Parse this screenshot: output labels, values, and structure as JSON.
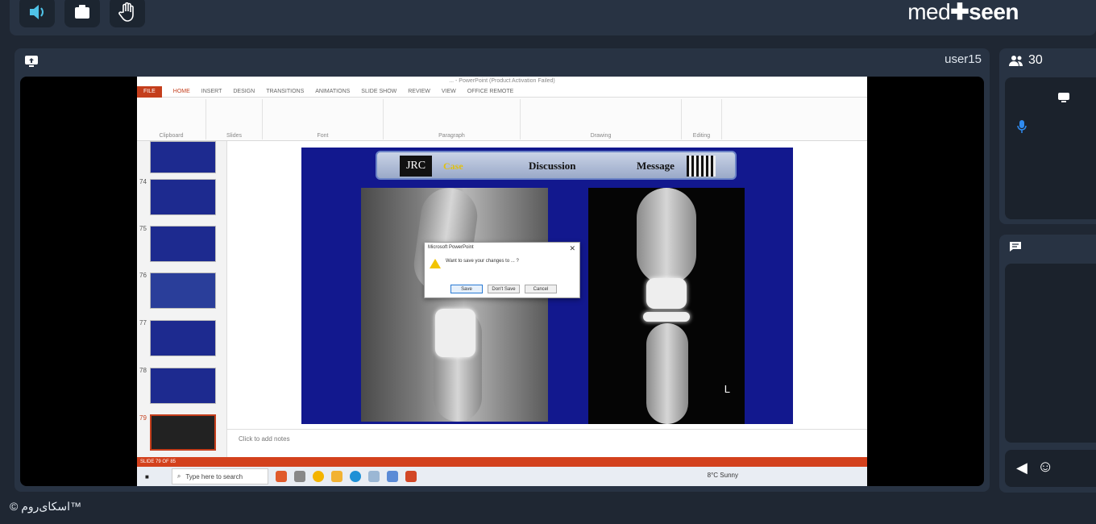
{
  "topbar": {
    "buttons": [
      "speaker-icon",
      "presentation-icon",
      "raise-hand-icon"
    ],
    "logo_left": "med",
    "logo_right": "seen"
  },
  "stage": {
    "presenter": "user15"
  },
  "powerpoint": {
    "title": "... - PowerPoint (Product Activation Failed)",
    "menu": [
      "FILE",
      "HOME",
      "INSERT",
      "DESIGN",
      "TRANSITIONS",
      "ANIMATIONS",
      "SLIDE SHOW",
      "REVIEW",
      "VIEW",
      "OFFICE REMOTE"
    ],
    "ribbon_groups": [
      "Clipboard",
      "Slides",
      "Font",
      "Paragraph",
      "Drawing",
      "Editing"
    ],
    "thumb_numbers": [
      "74",
      "75",
      "76",
      "77",
      "78",
      "79"
    ],
    "slide": {
      "logo": "JRC",
      "case": "Case",
      "discussion": "Discussion",
      "message": "Message",
      "side_marker": "L"
    },
    "dialog": {
      "title": "Microsoft PowerPoint",
      "close": "✕",
      "message": "Want to save your changes to ... ?",
      "buttons": [
        "Save",
        "Don't Save",
        "Cancel"
      ]
    },
    "notes_placeholder": "Click to add notes",
    "status": "SLIDE 79 OF 85",
    "taskbar": {
      "search_placeholder": "Type here to search",
      "weather": "8°C Sunny"
    }
  },
  "sidebar": {
    "participants_count": "30"
  },
  "footer": {
    "brand": "© اسکای‌روم™"
  }
}
